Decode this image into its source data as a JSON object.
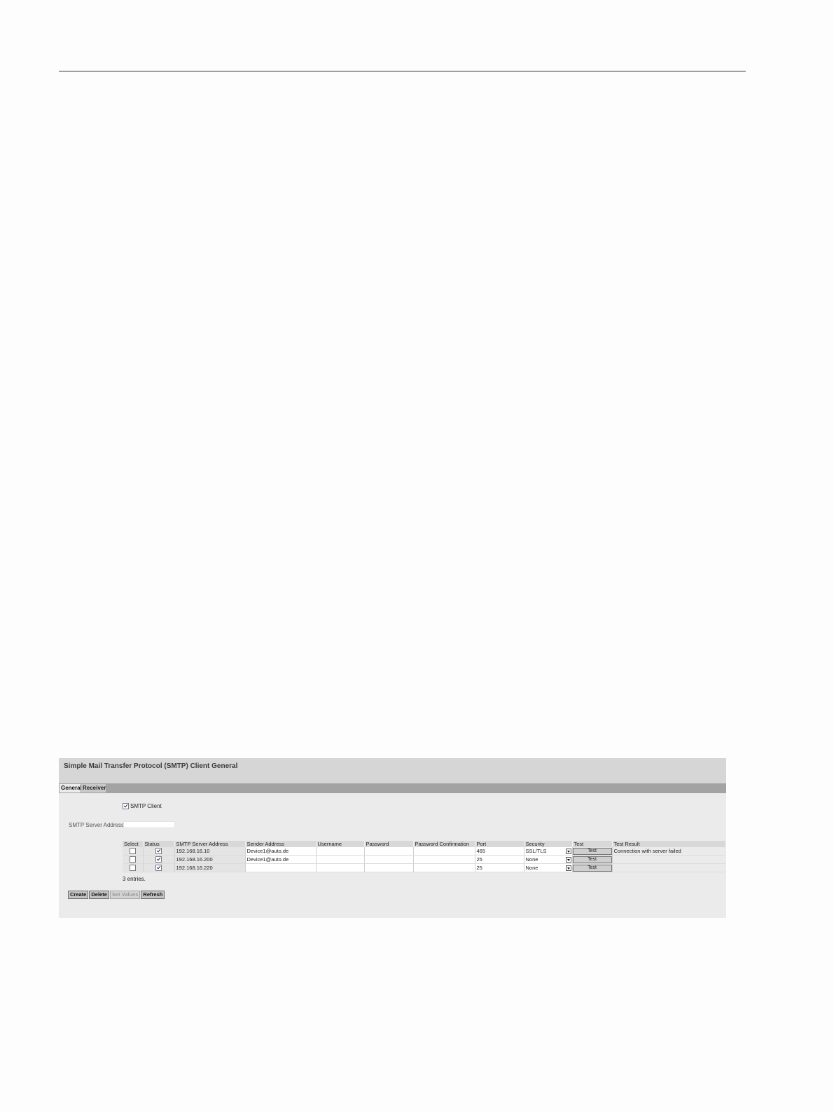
{
  "header": {
    "title": "Simple Mail Transfer Protocol (SMTP) Client General"
  },
  "tabs": [
    {
      "label": "General",
      "active": true
    },
    {
      "label": "Receiver",
      "active": false
    }
  ],
  "smtp_client": {
    "label": "SMTP Client",
    "checked": true
  },
  "server_address": {
    "label": "SMTP Server Address:",
    "value": ""
  },
  "table": {
    "columns": [
      "Select",
      "Status",
      "SMTP Server Address",
      "Sender Address",
      "Username",
      "Password",
      "Password Confirmation",
      "Port",
      "Security",
      "Test",
      "Test Result"
    ],
    "rows": [
      {
        "select": false,
        "status": true,
        "server": "192.168.16.10",
        "sender": "Device1@auto.de",
        "username": "",
        "password": "",
        "confirm": "",
        "port": "465",
        "security": "SSL/TLS",
        "test_label": "Test",
        "result": "Connection with server failed"
      },
      {
        "select": false,
        "status": true,
        "server": "192.168.16.200",
        "sender": "Device1@auto.de",
        "username": "",
        "password": "",
        "confirm": "",
        "port": "25",
        "security": "None",
        "test_label": "Test",
        "result": ""
      },
      {
        "select": false,
        "status": true,
        "server": "192.168.16.220",
        "sender": "",
        "username": "",
        "password": "",
        "confirm": "",
        "port": "25",
        "security": "None",
        "test_label": "Test",
        "result": ""
      }
    ],
    "entries_text": "3 entries."
  },
  "actions": {
    "create": "Create",
    "delete": "Delete",
    "set_values": "Set Values",
    "refresh": "Refresh"
  }
}
